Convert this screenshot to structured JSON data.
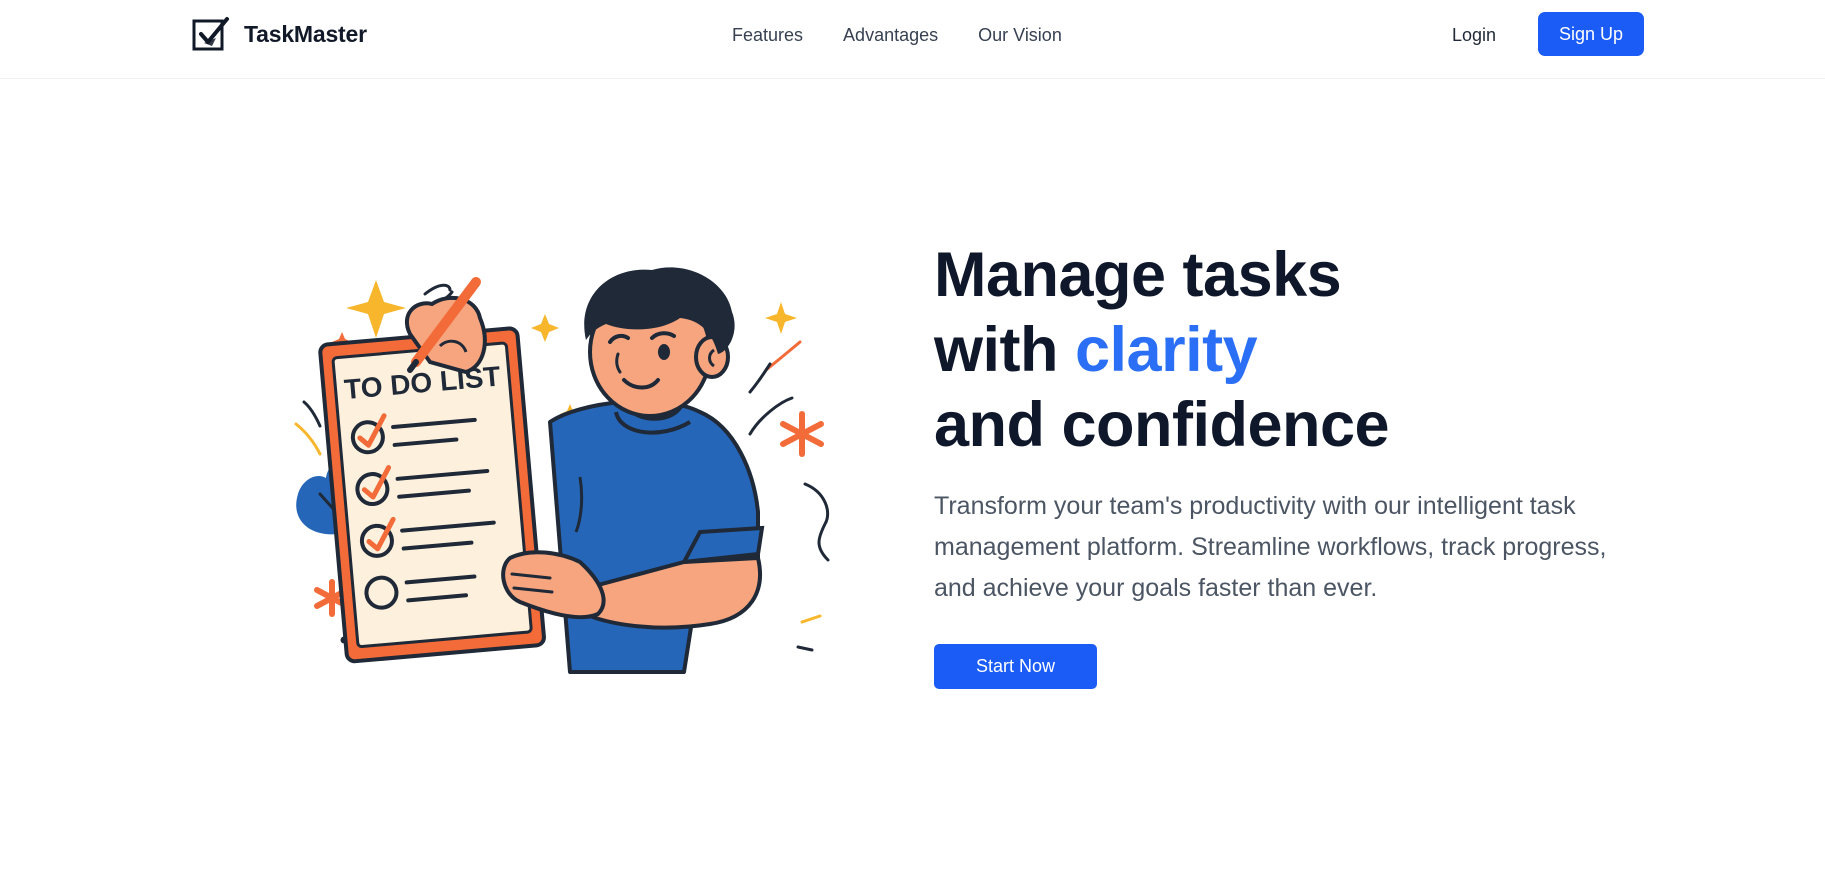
{
  "brand": {
    "name": "TaskMaster",
    "icon": "checkbox-logo-icon"
  },
  "nav": {
    "links": [
      {
        "label": "Features"
      },
      {
        "label": "Advantages"
      },
      {
        "label": "Our Vision"
      }
    ],
    "login_label": "Login",
    "signup_label": "Sign Up"
  },
  "hero": {
    "headline_line1": "Manage tasks",
    "headline_line2_prefix": "with ",
    "headline_line2_accent": "clarity",
    "headline_line3": "and confidence",
    "description": "Transform your team's productivity with our intelligent task management platform. Streamline workflows, track progress, and achieve your goals faster than ever.",
    "cta_label": "Start Now"
  },
  "illustration": {
    "icon": "person-holding-todo-list-illustration",
    "clipboard_title": "TO DO LIST"
  },
  "colors": {
    "primary": "#1a5cf5",
    "accent_text": "#2b6ff6",
    "heading": "#0f172a",
    "body_text": "#4b5563",
    "clipboard_orange": "#f26b38",
    "shirt_blue": "#2566b8",
    "sparkle_yellow": "#f8b62c"
  }
}
